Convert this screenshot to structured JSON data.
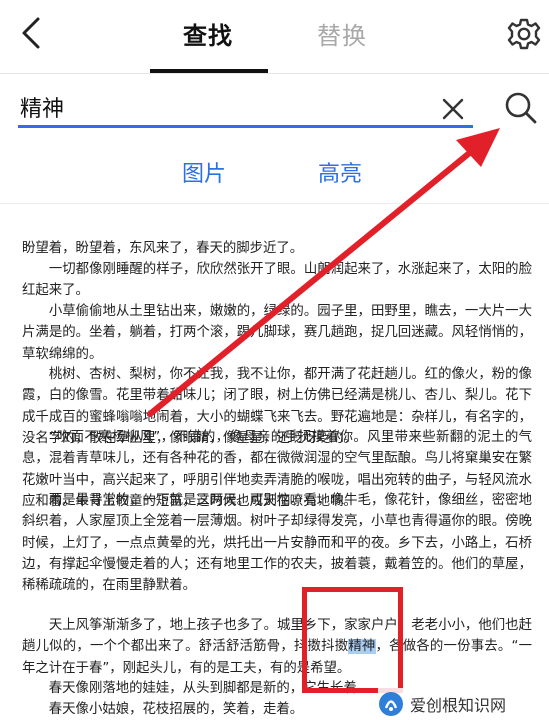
{
  "header": {
    "tabs": [
      {
        "label": "查找",
        "active": true
      },
      {
        "label": "替换",
        "active": false
      }
    ]
  },
  "search": {
    "value": "精神"
  },
  "options": {
    "image_label": "图片",
    "highlight_label": "高亮"
  },
  "document": {
    "p1": "盼望着，盼望着，东风来了，春天的脚步近了。",
    "p2": "　　一切都像刚睡醒的样子，欣欣然张开了眼。山朗润起来了，水涨起来了，太阳的脸红起来了。",
    "p3": "　　小草偷偷地从土里钻出来，嫩嫩的，绿绿的。园子里，田野里，瞧去，一大片一大片满是的。坐着，躺着，打两个滚，踢几脚球，赛几趟跑，捉几回迷藏。风轻悄悄的，草软绵绵的。",
    "p4": "　　桃树、杏树、梨树，你不让我，我不让你，都开满了花赶趟儿。红的像火，粉的像霞，白的像雪。花里带着甜味儿；闭了眼，树上仿佛已经满是桃儿、杏儿、梨儿。花下成千成百的蜜蜂嗡嗡地闹着，大小的蝴蝶飞来飞去。野花遍地是：杂样儿，有名字的，没名字的，散在草丛里，像眼睛，像星星，还眨呀眨的。",
    "p5": "　　“吹面不寒杨柳风”，不错的，像母亲的手抚摸着你。风里带来些新翻的泥土的气息，混着青草味儿，还有各种花的香，都在微微润湿的空气里酝酿。鸟儿将窠巢安在繁花嫩叶当中，高兴起来了，呼朋引伴地卖弄清脆的喉咙，唱出宛转的曲子，与轻风流水应和着。牛背上牧童的短笛，这时候也成天在嘹亮地响。",
    "p6": "　　雨是最寻常的，一下就是三两天。可别恼。看，像牛毛，像花针，像细丝，密密地斜织着，人家屋顶上全笼着一层薄烟。树叶子却绿得发亮，小草也青得逼你的眼。傍晚时候，上灯了，一点点黄晕的光，烘托出一片安静而和平的夜。乡下去，小路上，石桥边，有撑起伞慢慢走着的人；还有地里工作的农夫，披着蓑，戴着笠的。他们的草屋，稀稀疏疏的，在雨里静默着。",
    "p7_before": "　　天上风筝渐渐多了，地上孩子也多了。城里乡下，家家户户，老老小小，他们也赶趟儿似的，一个个都出来了。舒活舒活筋骨，抖擞抖擞",
    "p7_highlight": "精神",
    "p7_after": "，各做各的一份事去。“一年之计在于春”，刚起头儿，有的是工夫，有的是希望。",
    "p8": "　　春天像刚落地的娃娃，从头到脚都是新的，它生长着。",
    "p9": "　　春天像小姑娘，花枝招展的，笑着，走着。"
  },
  "watermark": {
    "text": "爱创根知识网"
  },
  "colors": {
    "accent": "#2d6fe6",
    "annotation": "#e2202a",
    "highlight": "#a9cdf4"
  },
  "icons": [
    "back-arrow-icon",
    "gear-icon",
    "clear-icon",
    "search-icon"
  ]
}
